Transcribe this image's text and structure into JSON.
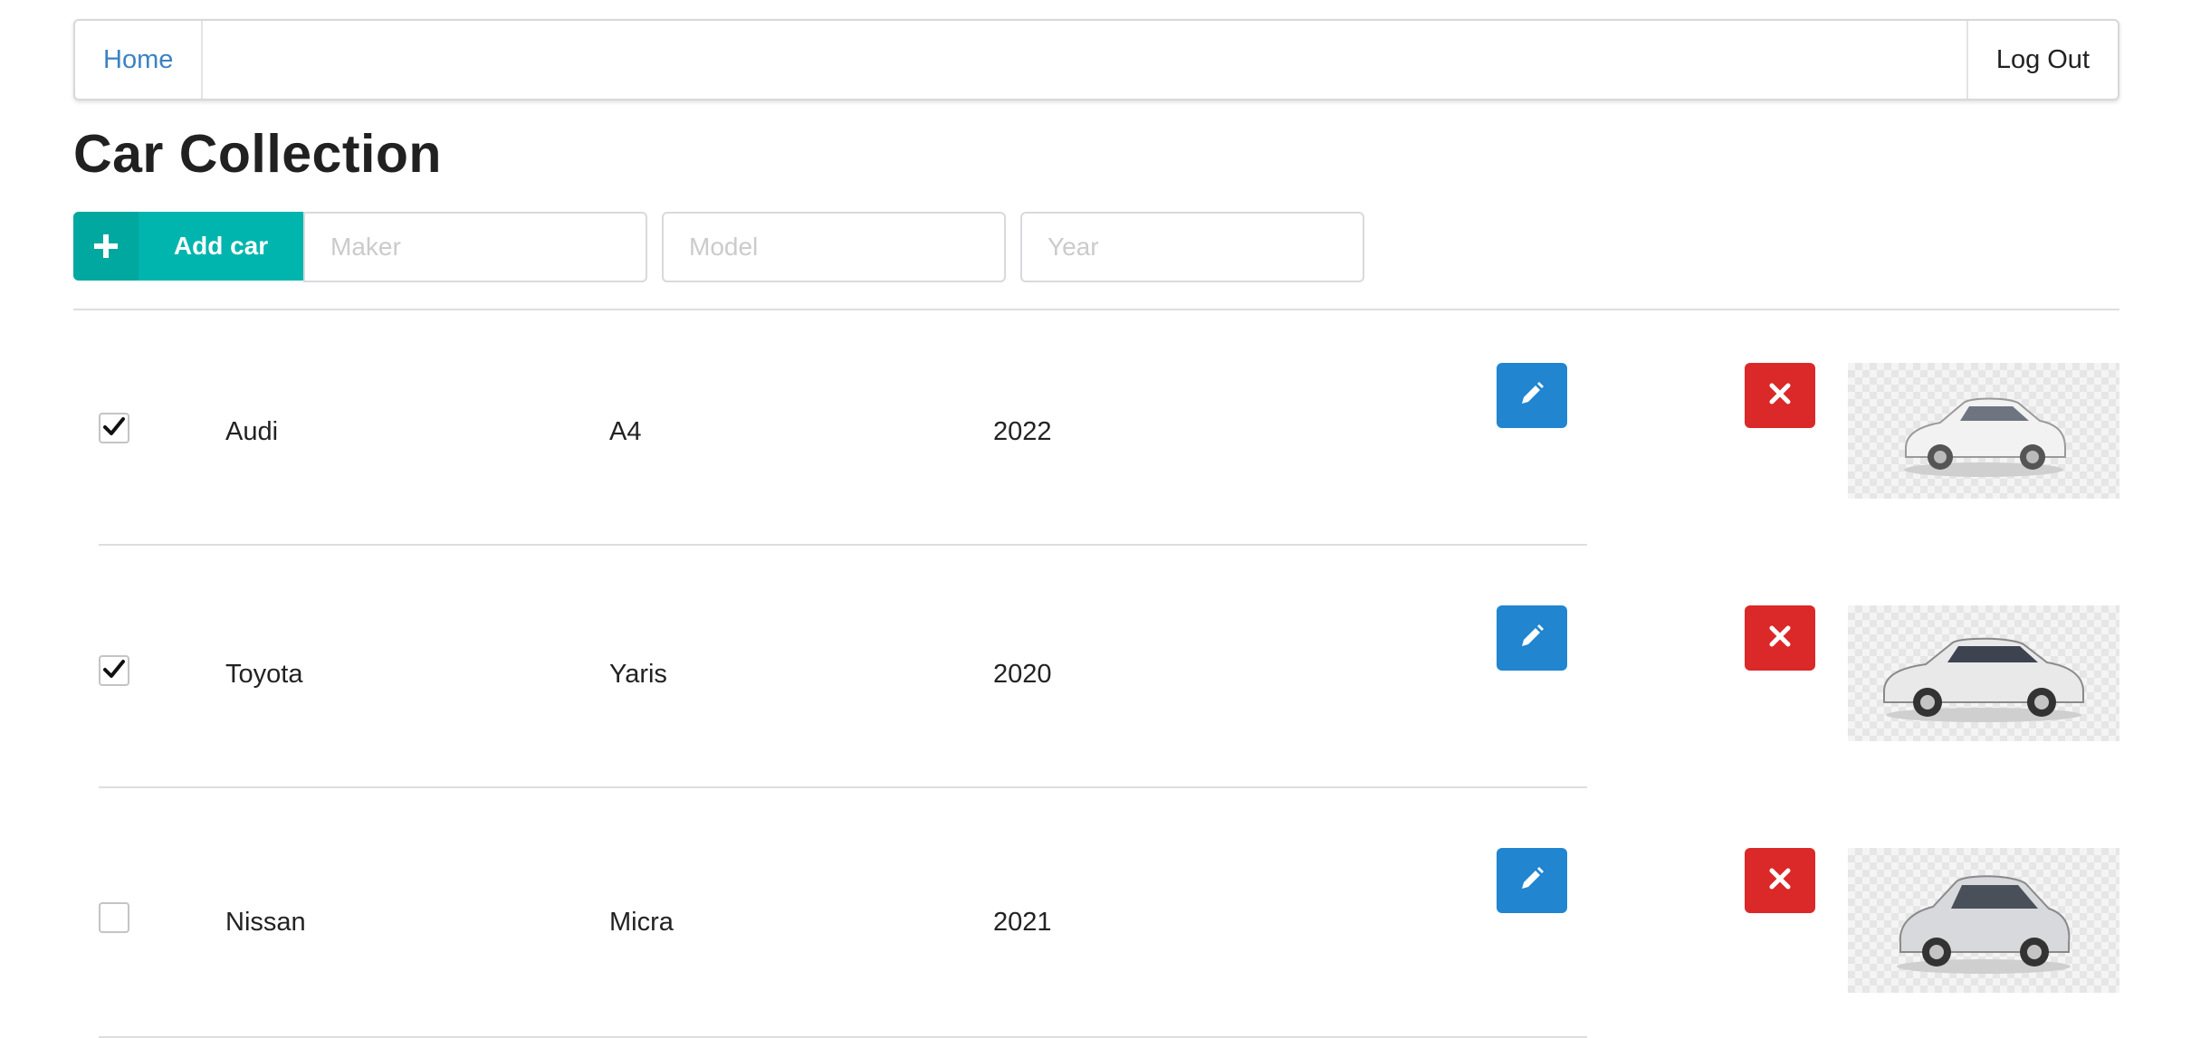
{
  "nav": {
    "home_label": "Home",
    "logout_label": "Log Out"
  },
  "page_title": "Car Collection",
  "add_form": {
    "button_icon": "plus-icon",
    "button_label": "Add car",
    "maker": {
      "placeholder": "Maker",
      "value": ""
    },
    "model": {
      "placeholder": "Model",
      "value": ""
    },
    "year": {
      "placeholder": "Year",
      "value": ""
    }
  },
  "cars": [
    {
      "checked": true,
      "maker": "Audi",
      "model": "A4",
      "year": "2022",
      "image": "white-audi-sedan"
    },
    {
      "checked": true,
      "maker": "Toyota",
      "model": "Yaris",
      "year": "2020",
      "image": "silver-toyota-sedan"
    },
    {
      "checked": false,
      "maker": "Nissan",
      "model": "Micra",
      "year": "2021",
      "image": "silver-nissan-hatchback"
    }
  ],
  "colors": {
    "add_button": "#00b5ad",
    "edit_button": "#2185d0",
    "delete_button": "#db2828",
    "home_link": "#3b82c4"
  },
  "icons": {
    "edit": "pencil-icon",
    "delete": "close-icon",
    "checked": "checkmark-icon"
  }
}
